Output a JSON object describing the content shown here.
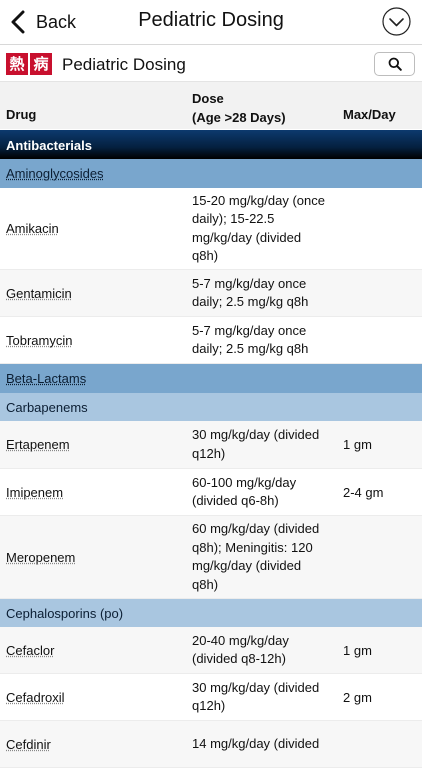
{
  "nav": {
    "back_label": "Back",
    "title": "Pediatric Dosing"
  },
  "subheader": {
    "logo_chars": [
      "熱",
      "病"
    ],
    "title": "Pediatric Dosing"
  },
  "table_header": {
    "drug": "Drug",
    "dose_line1": "Dose",
    "dose_line2": "(Age >28 Days)",
    "max": "Max/Day"
  },
  "rows": [
    {
      "kind": "section",
      "label": "Antibacterials"
    },
    {
      "kind": "group",
      "label": "Aminoglycosides"
    },
    {
      "kind": "drug",
      "name": "Amikacin",
      "dose": [
        "15-20 mg/kg/day (once",
        "daily); 15-22.5",
        "mg/kg/day (divided",
        "q8h)"
      ],
      "max": ""
    },
    {
      "kind": "drug",
      "name": "Gentamicin",
      "dose": [
        "5-7 mg/kg/day once",
        "daily; 2.5 mg/kg q8h"
      ],
      "max": ""
    },
    {
      "kind": "drug",
      "name": "Tobramycin",
      "dose": [
        "5-7 mg/kg/day once",
        "daily; 2.5 mg/kg q8h"
      ],
      "max": ""
    },
    {
      "kind": "group",
      "label": "Beta-Lactams"
    },
    {
      "kind": "subgroup",
      "label": "Carbapenems"
    },
    {
      "kind": "drug",
      "name": "Ertapenem",
      "dose": [
        "30 mg/kg/day (divided",
        "q12h)"
      ],
      "max": "1 gm"
    },
    {
      "kind": "drug",
      "name": "Imipenem",
      "dose": [
        "60-100 mg/kg/day",
        "(divided q6-8h)"
      ],
      "max": "2-4 gm"
    },
    {
      "kind": "drug",
      "name": "Meropenem",
      "dose": [
        "60 mg/kg/day (divided",
        "q8h); Meningitis: 120",
        "mg/kg/day (divided",
        "q8h)"
      ],
      "max": ""
    },
    {
      "kind": "subgroup",
      "label": "Cephalosporins (po)"
    },
    {
      "kind": "drug",
      "name": "Cefaclor",
      "dose": [
        "20-40 mg/kg/day",
        "(divided q8-12h)"
      ],
      "max": "1 gm"
    },
    {
      "kind": "drug",
      "name": "Cefadroxil",
      "dose": [
        "30 mg/kg/day (divided",
        "q12h)"
      ],
      "max": "2 gm"
    },
    {
      "kind": "drug",
      "name": "Cefdinir",
      "dose": [
        "14 mg/kg/day (divided"
      ],
      "max": ""
    }
  ]
}
